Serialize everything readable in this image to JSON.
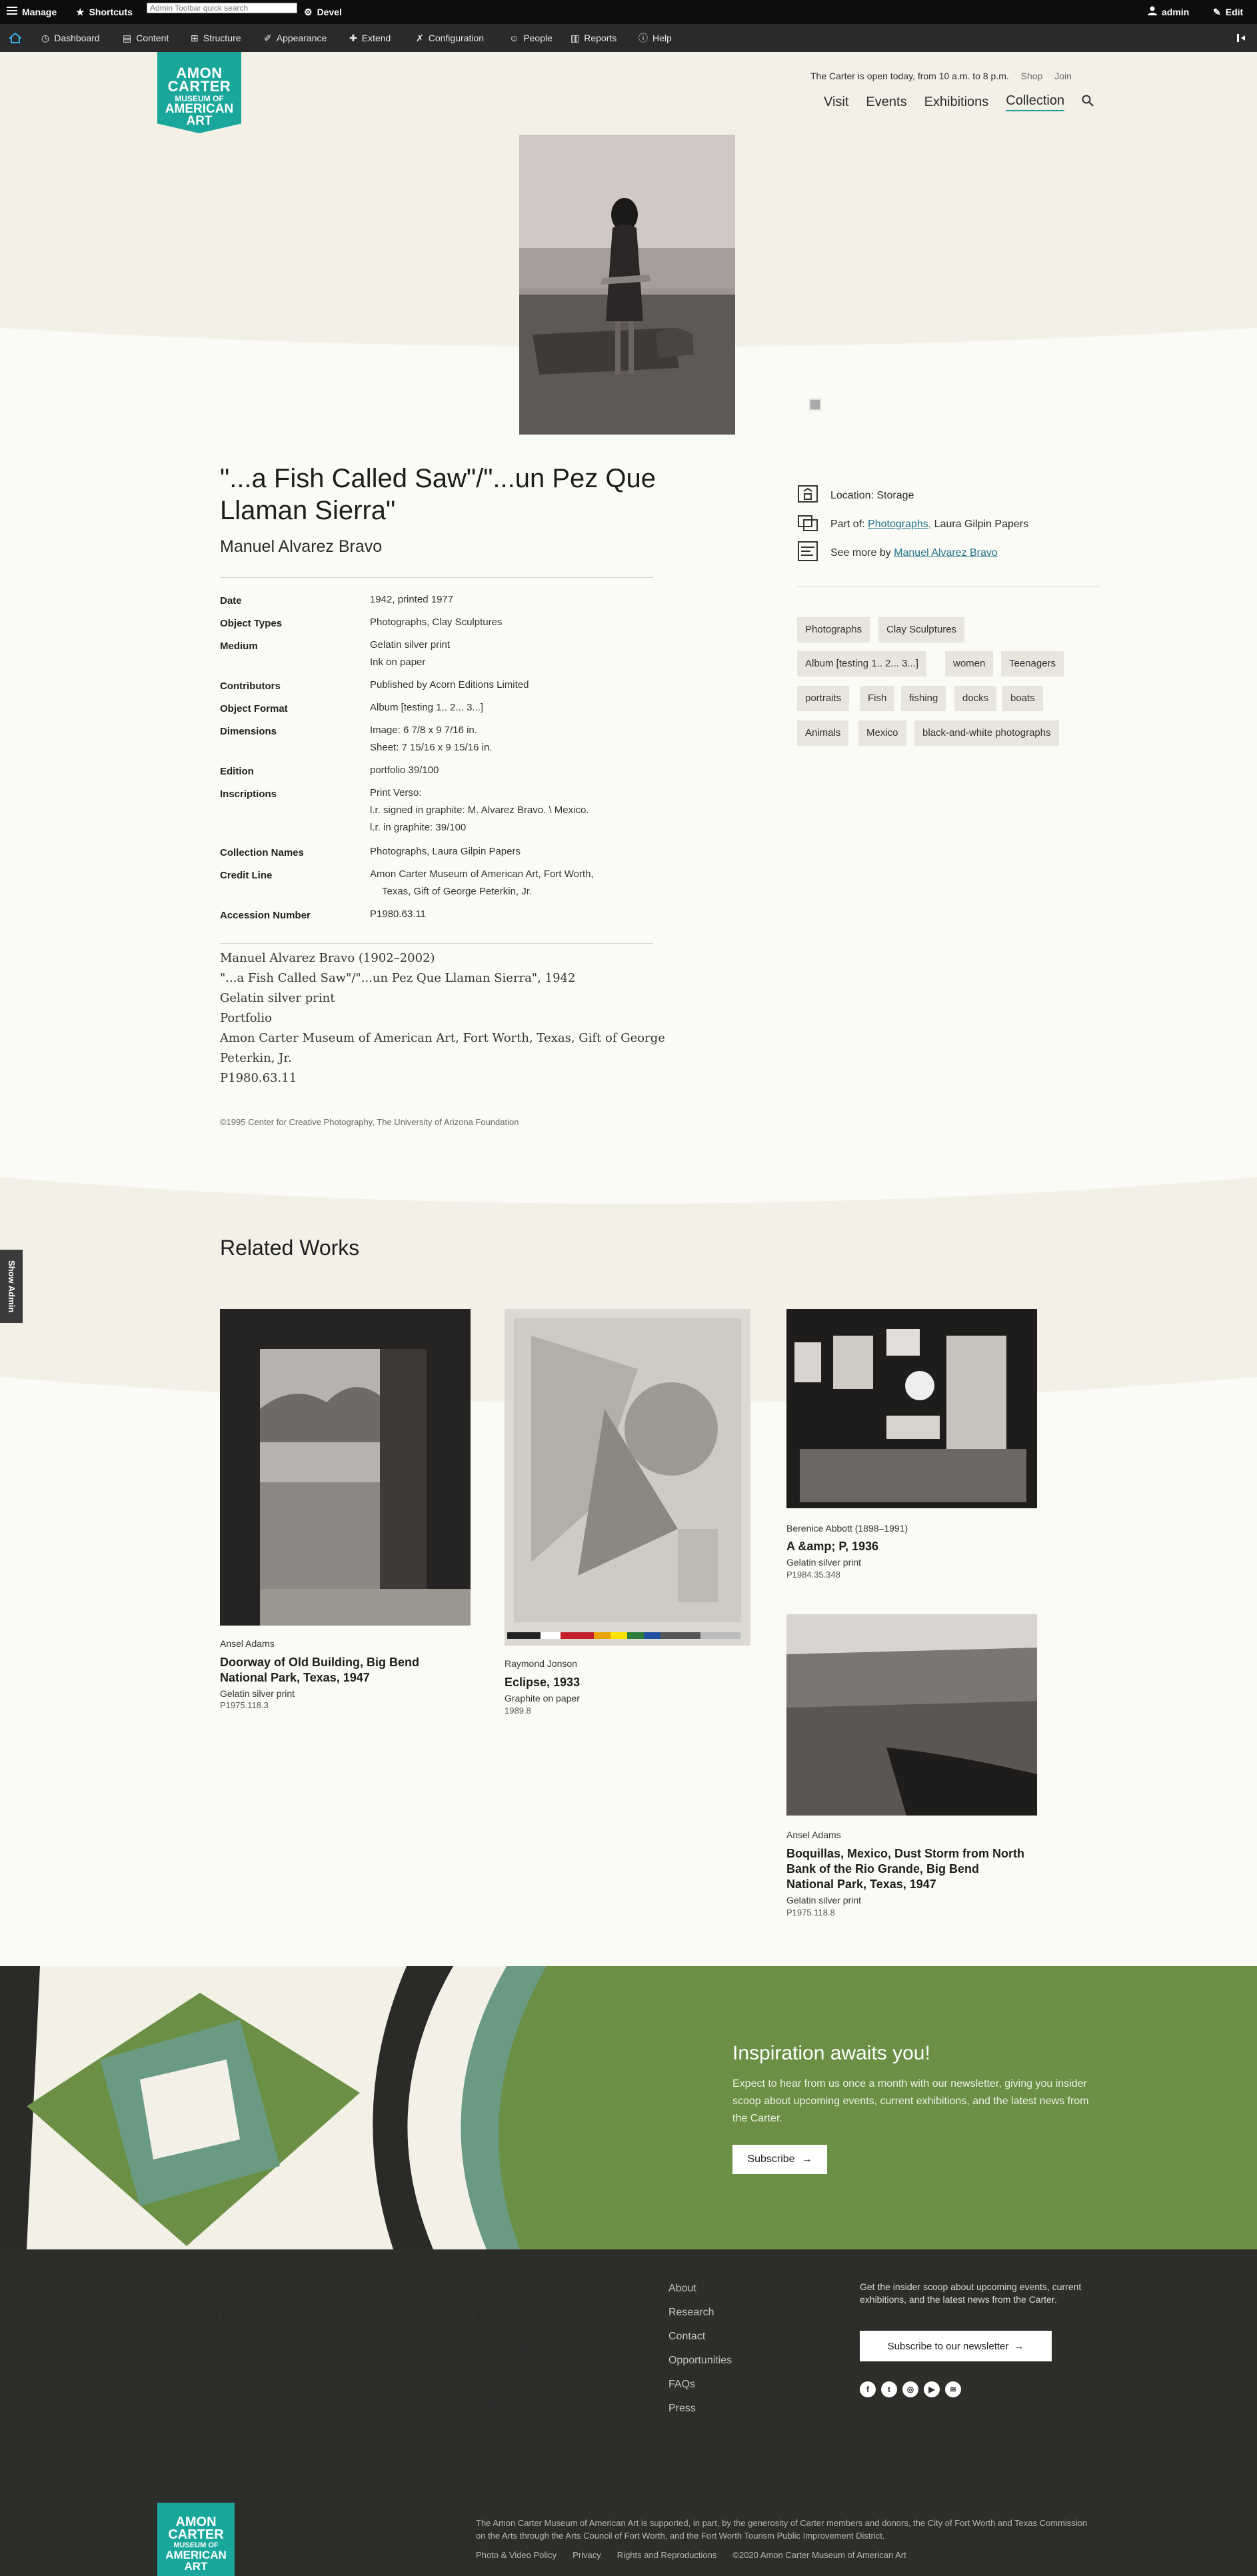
{
  "toolbar": {
    "manage": "Manage",
    "shortcuts": "Shortcuts",
    "search_placeholder": "Admin Toolbar quick search",
    "devel": "Devel",
    "user": "admin",
    "edit": "Edit",
    "items": [
      "Dashboard",
      "Content",
      "Structure",
      "Appearance",
      "Extend",
      "Configuration",
      "People",
      "Reports",
      "Help"
    ]
  },
  "header": {
    "logo": [
      "AMON",
      "CARTER",
      "MUSEUM OF",
      "AMERICAN",
      "ART"
    ],
    "hours": "The Carter is open today, from 10 a.m. to 8 p.m.",
    "shop": "Shop",
    "join": "Join",
    "nav": [
      "Visit",
      "Events",
      "Exhibitions",
      "Collection"
    ],
    "active_nav": "Collection"
  },
  "artwork": {
    "title": "\"...a Fish Called Saw\"/\"...un Pez Que Llaman Sierra\"",
    "artist": "Manuel Alvarez Bravo",
    "meta": [
      {
        "label": "Date",
        "value": [
          "1942, printed 1977"
        ]
      },
      {
        "label": "Object Types",
        "value": [
          "Photographs, Clay Sculptures"
        ]
      },
      {
        "label": "Medium",
        "value": [
          "Gelatin silver print",
          "Ink on paper"
        ]
      },
      {
        "label": "Contributors",
        "value": [
          "Published by Acorn Editions Limited"
        ]
      },
      {
        "label": "Object Format",
        "value": [
          "Album [testing 1.. 2... 3...]"
        ]
      },
      {
        "label": "Dimensions",
        "value": [
          "Image: 6 7/8 x 9 7/16 in.",
          "Sheet: 7 15/16 x 9 15/16 in."
        ]
      },
      {
        "label": "Edition",
        "value": [
          "portfolio 39/100"
        ]
      },
      {
        "label": "Inscriptions",
        "value": [
          "Print Verso:",
          "l.r. signed in graphite: M. Alvarez Bravo. \\ Mexico.",
          "l.r. in graphite: 39/100"
        ]
      },
      {
        "label": "Collection Names",
        "value": [
          "Photographs, Laura Gilpin Papers"
        ]
      },
      {
        "label": "Credit Line",
        "value": [
          "Amon Carter Museum of American Art, Fort Worth,",
          "Texas, Gift of George Peterkin, Jr."
        ]
      },
      {
        "label": "Accession Number",
        "value": [
          "P1980.63.11"
        ]
      }
    ],
    "citation": [
      "Manuel Alvarez Bravo (1902–2002)",
      "\"...a Fish Called Saw\"/\"...un Pez Que Llaman Sierra\", 1942",
      "Gelatin silver print",
      "Portfolio",
      "Amon Carter Museum of American Art, Fort Worth, Texas, Gift of George",
      "Peterkin, Jr.",
      "P1980.63.11"
    ],
    "copyright": "©1995 Center for Creative Photography, The University of Arizona Foundation"
  },
  "side": {
    "location": "Location: Storage",
    "part_of_prefix": "Part of:",
    "part_of_link": "Photographs,",
    "part_of_rest": "Laura Gilpin Papers",
    "see_more_prefix": "See more by",
    "see_more_link": "Manuel Alvarez Bravo",
    "tags": [
      "Photographs",
      "Clay Sculptures",
      "Album [testing 1.. 2... 3...]",
      "women",
      "Teenagers",
      "portraits",
      "Fish",
      "fishing",
      "docks",
      "boats",
      "Animals",
      "Mexico",
      "black-and-white photographs"
    ]
  },
  "related": {
    "heading": "Related Works",
    "works": [
      {
        "artist": "Ansel Adams",
        "title": [
          "Doorway of Old Building, Big Bend",
          "National Park, Texas, 1947"
        ],
        "medium": "Gelatin silver print",
        "acc": "P1975.118.3"
      },
      {
        "artist": "Raymond Jonson",
        "title": [
          "Eclipse, 1933"
        ],
        "medium": "Graphite on paper",
        "acc": "1989.8"
      },
      {
        "artist": "Berenice Abbott (1898–1991)",
        "title": [
          "A &amp; P, 1936"
        ],
        "medium": "Gelatin silver print",
        "acc": "P1984.35.348"
      },
      {
        "artist": "Ansel Adams",
        "title": [
          "Boquillas, Mexico, Dust Storm from North",
          "Bank of the Rio Grande, Big Bend",
          "National Park, Texas, 1947"
        ],
        "medium": "Gelatin silver print",
        "acc": "P1975.118.8"
      }
    ]
  },
  "show_admin": "Show Admin",
  "newsletter": {
    "title": "Inspiration awaits you!",
    "body": "Expect to hear from us once a month with our newsletter, giving you insider scoop about upcoming events, current exhibitions, and the latest news from the Carter.",
    "button": "Subscribe"
  },
  "footer": {
    "open": [
      "The Carter is open today,",
      "from 10 a.m. to 8 p.m."
    ],
    "address": [
      "3501 Camp Bowie Blvd.",
      "Fort Worth, TX 76107",
      "817.738.1933"
    ],
    "nav": [
      "Visit",
      "Events",
      "Exhibitions",
      "Collection",
      "Shop",
      "Join"
    ],
    "links": [
      "About",
      "Research",
      "Contact",
      "Opportunities",
      "FAQs",
      "Press"
    ],
    "insider": "Get the insider scoop about upcoming events, current exhibitions, and the latest news from the Carter.",
    "newsletter_button": "Subscribe to our newsletter",
    "social": [
      "facebook-icon",
      "twitter-icon",
      "instagram-icon",
      "youtube-icon",
      "spotify-icon"
    ],
    "logo": [
      "AMON",
      "CARTER",
      "MUSEUM OF",
      "AMERICAN",
      "ART"
    ],
    "legal": "The Amon Carter Museum of American Art is supported, in part, by the generosity of Carter members and donors, the City of Fort Worth and Texas Commission on the Arts through the Arts Council of Fort Worth, and the Fort Worth Tourism Public Improvement District.",
    "bottom": [
      "Photo & Video Policy",
      "Privacy",
      "Rights and Reproductions",
      "©2020 Amon Carter Museum of American Art"
    ]
  },
  "colors": {
    "teal": "#1aa79b",
    "green": "#6a8f45",
    "footer": "#2d2d2a",
    "link": "#1d6f8a"
  }
}
